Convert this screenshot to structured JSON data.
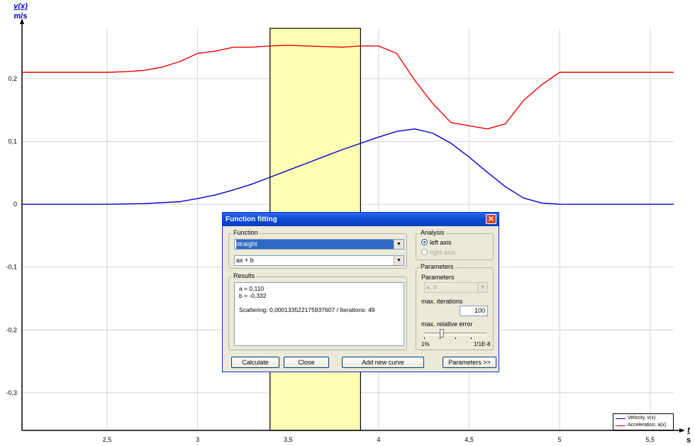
{
  "chart_data": {
    "type": "line",
    "y_axis_label": "v(x)",
    "y_axis_unit": "m/s",
    "x_axis_label": "t",
    "x_axis_unit": "s",
    "xlim": [
      2.03,
      5.63
    ],
    "ylim": [
      -0.36,
      0.28
    ],
    "x_ticks": [
      2.5,
      3,
      3.5,
      4,
      4.5,
      5,
      5.5
    ],
    "x_tick_labels": [
      "2,5",
      "3",
      "3,5",
      "4",
      "4,5",
      "5",
      "5,5"
    ],
    "y_ticks": [
      0.2,
      0.1,
      0,
      -0.1,
      -0.2,
      -0.3
    ],
    "y_tick_labels": [
      "0,2",
      "0,1",
      "0",
      "-0,1",
      "-0,2",
      "-0,3"
    ],
    "highlight_range": [
      3.4,
      3.9
    ],
    "grid": true,
    "series": [
      {
        "name": "Velocity, v(x)",
        "color": "#0000cc",
        "x": [
          2.03,
          2.5,
          2.7,
          2.9,
          3.0,
          3.1,
          3.2,
          3.3,
          3.4,
          3.5,
          3.6,
          3.7,
          3.8,
          3.9,
          4.0,
          4.1,
          4.2,
          4.3,
          4.4,
          4.5,
          4.6,
          4.7,
          4.8,
          4.9,
          5.0,
          5.2,
          5.4,
          5.63
        ],
        "y": [
          0,
          0,
          0.001,
          0.004,
          0.009,
          0.015,
          0.023,
          0.032,
          0.043,
          0.054,
          0.065,
          0.076,
          0.087,
          0.097,
          0.107,
          0.116,
          0.12,
          0.113,
          0.097,
          0.075,
          0.051,
          0.028,
          0.01,
          0.002,
          0,
          0,
          0,
          0
        ]
      },
      {
        "name": "Acceleration, a(x)",
        "color": "#ee0000",
        "x": [
          2.03,
          2.5,
          2.6,
          2.7,
          2.8,
          2.9,
          3.0,
          3.1,
          3.2,
          3.3,
          3.4,
          3.5,
          3.6,
          3.7,
          3.8,
          3.9,
          4.0,
          4.1,
          4.2,
          4.3,
          4.4,
          4.5,
          4.6,
          4.7,
          4.8,
          4.9,
          5.0,
          5.2,
          5.4,
          5.63
        ],
        "y": [
          0.21,
          0.21,
          0.211,
          0.213,
          0.218,
          0.227,
          0.24,
          0.244,
          0.25,
          0.25,
          0.252,
          0.253,
          0.252,
          0.251,
          0.25,
          0.252,
          0.252,
          0.24,
          0.197,
          0.16,
          0.13,
          0.125,
          0.12,
          0.128,
          0.165,
          0.19,
          0.21,
          0.21,
          0.21,
          0.21
        ]
      }
    ]
  },
  "legend": {
    "items": [
      {
        "label": "Velocity, v(x)",
        "color": "#0000cc"
      },
      {
        "label": "Acceleration, a(x)",
        "color": "#ee0000"
      }
    ]
  },
  "dialog": {
    "title": "Function fitting",
    "close_glyph": "✕",
    "function_group_label": "Function",
    "function_select": "straight",
    "formula_select": "ax + b",
    "results_group_label": "Results",
    "results_lines": [
      "a = 0,110",
      "b = -0,332",
      "",
      "Scattering: 0,000133522175937607  /  Iterations: 49"
    ],
    "analysis_group_label": "Analysis",
    "radio_left": "left axis",
    "radio_right": "right axis",
    "parameters_group_label": "Parameters",
    "parameters_label": "Parameters",
    "parameters_select": "a, b",
    "max_iterations_label": "max. iterations",
    "max_iterations_value": "100",
    "max_rel_error_label": "max. relative error",
    "slider_min": "1%",
    "slider_max": "1!1E-8",
    "btn_calculate": "Calculate",
    "btn_close": "Close",
    "btn_add_curve": "Add new curve",
    "btn_parameters": "Parameters >>"
  }
}
